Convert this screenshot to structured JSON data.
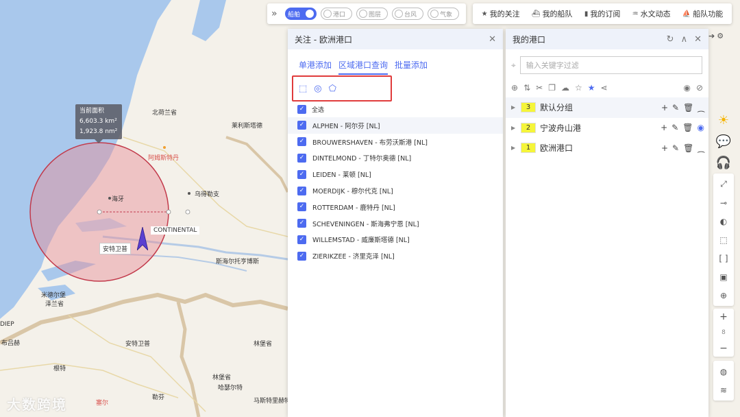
{
  "colors": {
    "accent": "#4d6bf0",
    "highlight_border": "#e03b3b",
    "group_badge": "#f5f53a",
    "map_water": "#a9c8ec",
    "map_land": "#f4f1ea"
  },
  "layers": {
    "expand_icon": "double-chevron-right-icon",
    "toggles": [
      {
        "label": "船舶",
        "on": true
      },
      {
        "label": "港口",
        "on": false
      },
      {
        "label": "图层",
        "on": false
      },
      {
        "label": "台风",
        "on": false
      },
      {
        "label": "气象",
        "on": false
      }
    ]
  },
  "nav": {
    "items": [
      {
        "label": "我的关注",
        "icon": "star-icon"
      },
      {
        "label": "我的船队",
        "icon": "fleet-icon"
      },
      {
        "label": "我的订阅",
        "icon": "bookmark-icon"
      },
      {
        "label": "水文动态",
        "icon": "tide-icon"
      },
      {
        "label": "船队功能",
        "icon": "ship-icon"
      }
    ]
  },
  "map": {
    "area_tip": {
      "title": "当前面积",
      "km": "6,603.3 km²",
      "nm": "1,923.8 nm²"
    },
    "labels": {
      "north_holland": "北荷兰省",
      "friesland": "莱利斯塔德",
      "amsterdam": "阿姆斯特丹",
      "hague": "海牙",
      "utrecht": "乌得勒支",
      "antwerp_river": "安特卫普",
      "hertogenbosch": "斯海尔托亨博斯",
      "middelburg": "米德尔堡",
      "zeeland": "泽兰省",
      "dieppe": "DIEP",
      "bruges": "布吕赫",
      "antwerp": "安特卫普",
      "limburg_be": "林堡省",
      "hasselt": "哈瑟尔特",
      "ghent": "根特",
      "leuven": "勒芬",
      "maastricht": "马斯特里赫特",
      "limburg_nl": "林堡省",
      "brussels": "塞尔",
      "continental": "CONTINENTAL"
    },
    "watermark": "大数跨境"
  },
  "follow_panel": {
    "title": "关注 - 欧洲港口",
    "tabs": [
      "单港添加",
      "区域港口查询",
      "批量添加"
    ],
    "active_tab": 1,
    "draw_tools": [
      "rectangle-select-icon",
      "circle-select-icon",
      "polygon-select-icon"
    ],
    "select_all": "全选",
    "ports": [
      "ALPHEN - 阿尔芬 [NL]",
      "BROUWERSHAVEN - 布劳沃斯港 [NL]",
      "DINTELMOND - 丁特尔奥德 [NL]",
      "LEIDEN - 莱顿 [NL]",
      "MOERDIJK - 穆尔代克 [NL]",
      "ROTTERDAM - 鹿特丹 [NL]",
      "SCHEVENINGEN - 斯海弗宁恩 [NL]",
      "WILLEMSTAD - 威廉斯塔德 [NL]",
      "ZIERIKZEE - 济里克泽 [NL]"
    ]
  },
  "port_panel": {
    "title": "我的港口",
    "filter_placeholder": "输入关键字过滤",
    "groups": [
      {
        "count": "3",
        "name": "默认分组",
        "visible": false
      },
      {
        "count": "2",
        "name": "宁波舟山港",
        "visible": true
      },
      {
        "count": "1",
        "name": "欧洲港口",
        "visible": false
      }
    ]
  },
  "zoom": {
    "level": "8"
  }
}
